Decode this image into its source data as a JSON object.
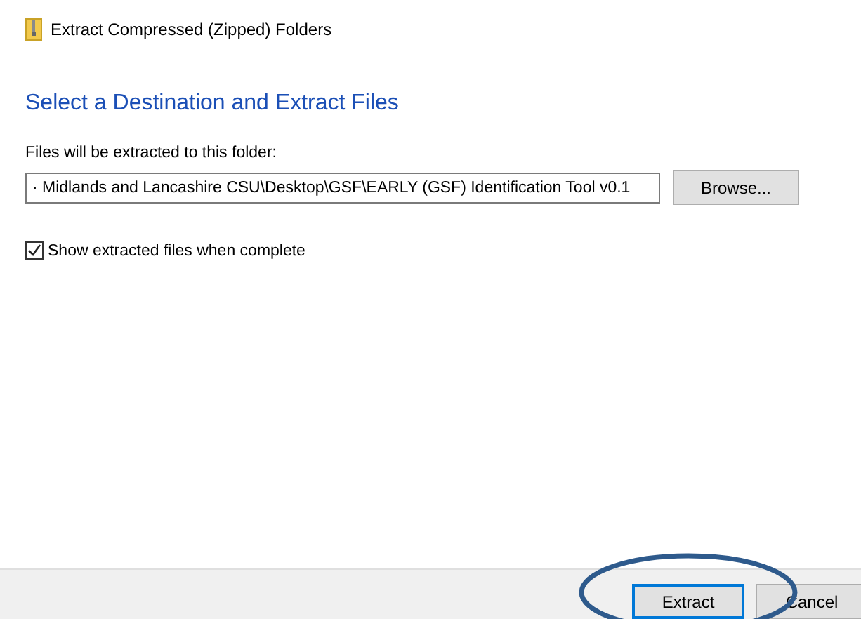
{
  "window": {
    "title": "Extract Compressed (Zipped) Folders"
  },
  "heading": "Select a Destination and Extract Files",
  "destination": {
    "label": "Files will be extracted to this folder:",
    "value": "· Midlands and Lancashire CSU\\Desktop\\GSF\\EARLY (GSF) Identification Tool v0.1"
  },
  "browse_button": "Browse...",
  "show_files": {
    "label": "Show extracted files when complete",
    "checked": true
  },
  "buttons": [
    {
      "label": "Extract",
      "default": true
    },
    {
      "label": "Cancel",
      "default": false
    }
  ]
}
